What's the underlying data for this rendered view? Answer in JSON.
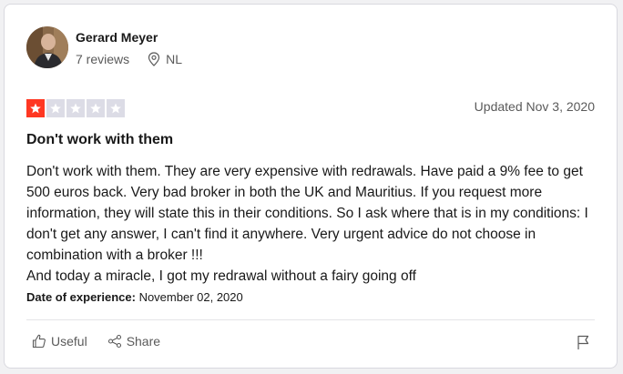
{
  "reviewer": {
    "name": "Gerard Meyer",
    "reviews": "7 reviews",
    "country": "NL"
  },
  "review": {
    "rating": 1,
    "rating_max": 5,
    "updated": "Updated Nov 3, 2020",
    "title": "Don't work with them",
    "body": [
      "Don't work with them. They are very expensive with redrawals. Have paid a 9% fee to get 500 euros back. Very bad broker in both the UK and Mauritius. If you request more information, they will state this in their conditions. So I ask where that is in my conditions: I don't get any answer, I can't find it anywhere. Very urgent advice do not choose in combination with a broker !!!",
      "And today a miracle, I got my redrawal without a fairy going off"
    ],
    "experience_label": "Date of experience:",
    "experience_date": "November 02, 2020"
  },
  "actions": {
    "useful_label": "Useful",
    "share_label": "Share"
  },
  "colors": {
    "star_filled": "#ff3722",
    "star_empty": "#dcdce6"
  },
  "icons": [
    "location-pin-icon",
    "thumbs-up-icon",
    "share-icon",
    "flag-icon",
    "star-icon"
  ]
}
